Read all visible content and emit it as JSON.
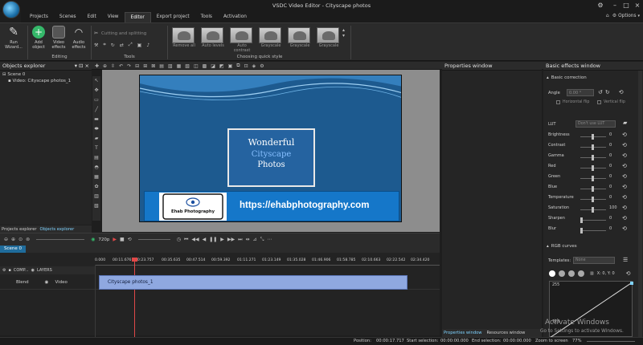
{
  "window": {
    "title": "VSDC Video Editor - Cityscape photos",
    "options_label": "Options"
  },
  "menu": {
    "items": [
      "Projects",
      "Scenes",
      "Edit",
      "View",
      "Editor",
      "Export project",
      "Tools",
      "Activation"
    ],
    "active": "Editor"
  },
  "ribbon": {
    "run_wizard": "Run Wizard...",
    "add_object": "Add object",
    "video_effects": "Video effects",
    "audio_effects": "Audio effects",
    "editing_label": "Editing",
    "cutting_label": "Cutting and splitting",
    "tools_label": "Tools",
    "quick_style_label": "Choosing quick style",
    "styles": [
      "Remove all",
      "Auto levels",
      "Auto contrast",
      "Grayscale",
      "Grayscale",
      "Grayscale"
    ]
  },
  "objects_explorer": {
    "title": "Objects explorer",
    "tree": [
      "Scene 0",
      "Video: Cityscape photos_1"
    ],
    "tabs": [
      "Projects explorer",
      "Objects explorer"
    ]
  },
  "video": {
    "title_line1": "Wonderful",
    "title_line2": "Cityscape",
    "title_line3": "Photos",
    "logo_text": "Ehab Photography",
    "url": "https://ehabphotography.com"
  },
  "timeline": {
    "quality": "720p",
    "scene_tab": "Scene 0",
    "ruler": [
      "0.000",
      "00:11.676",
      "00:23.757",
      "00:35.635",
      "00:47.514",
      "00:59.392",
      "01:11.271",
      "01:23.149",
      "01:35.028",
      "01:46.906",
      "01:58.785",
      "02:10.663",
      "02:22.542",
      "02:34.420"
    ],
    "header_comp": "COMP...",
    "header_layers": "LAYERS",
    "blend": "Blend",
    "track": "Video",
    "clip": "Cityscape photos_1"
  },
  "properties": {
    "title": "Properties window",
    "tabs": [
      "Properties window",
      "Resources window"
    ]
  },
  "effects": {
    "title": "Basic effects window",
    "basic_correction": "Basic correction",
    "angle_label": "Angle",
    "angle_value": "0.00 °",
    "hflip": "Horizontal flip",
    "vflip": "Vertical flip",
    "lut_label": "LUT",
    "lut_value": "Don't use LUT",
    "params": [
      {
        "name": "Brightness",
        "value": "0"
      },
      {
        "name": "Contrast",
        "value": "0"
      },
      {
        "name": "Gamma",
        "value": "0"
      },
      {
        "name": "Red",
        "value": "0"
      },
      {
        "name": "Green",
        "value": "0"
      },
      {
        "name": "Blue",
        "value": "0"
      },
      {
        "name": "Temperature",
        "value": "0"
      },
      {
        "name": "Saturation",
        "value": "100"
      },
      {
        "name": "Sharpen",
        "value": "0"
      },
      {
        "name": "Blur",
        "value": "0"
      }
    ],
    "rgb_curves": "RGB curves",
    "templates_label": "Templates:",
    "templates_value": "None",
    "xy": "X: 0, Y: 0",
    "curve_top": "255",
    "curve_bottom": "128"
  },
  "status": {
    "position_label": "Position:",
    "position_value": "00:00:17.717",
    "start_label": "Start selection:",
    "start_value": "00:00:00.000",
    "end_label": "End selection:",
    "end_value": "00:00:00.000",
    "zoom_label": "Zoom to screen",
    "zoom_value": "77%"
  },
  "watermark": {
    "title": "Activate Windows",
    "subtitle": "Go to Settings to activate Windows."
  }
}
